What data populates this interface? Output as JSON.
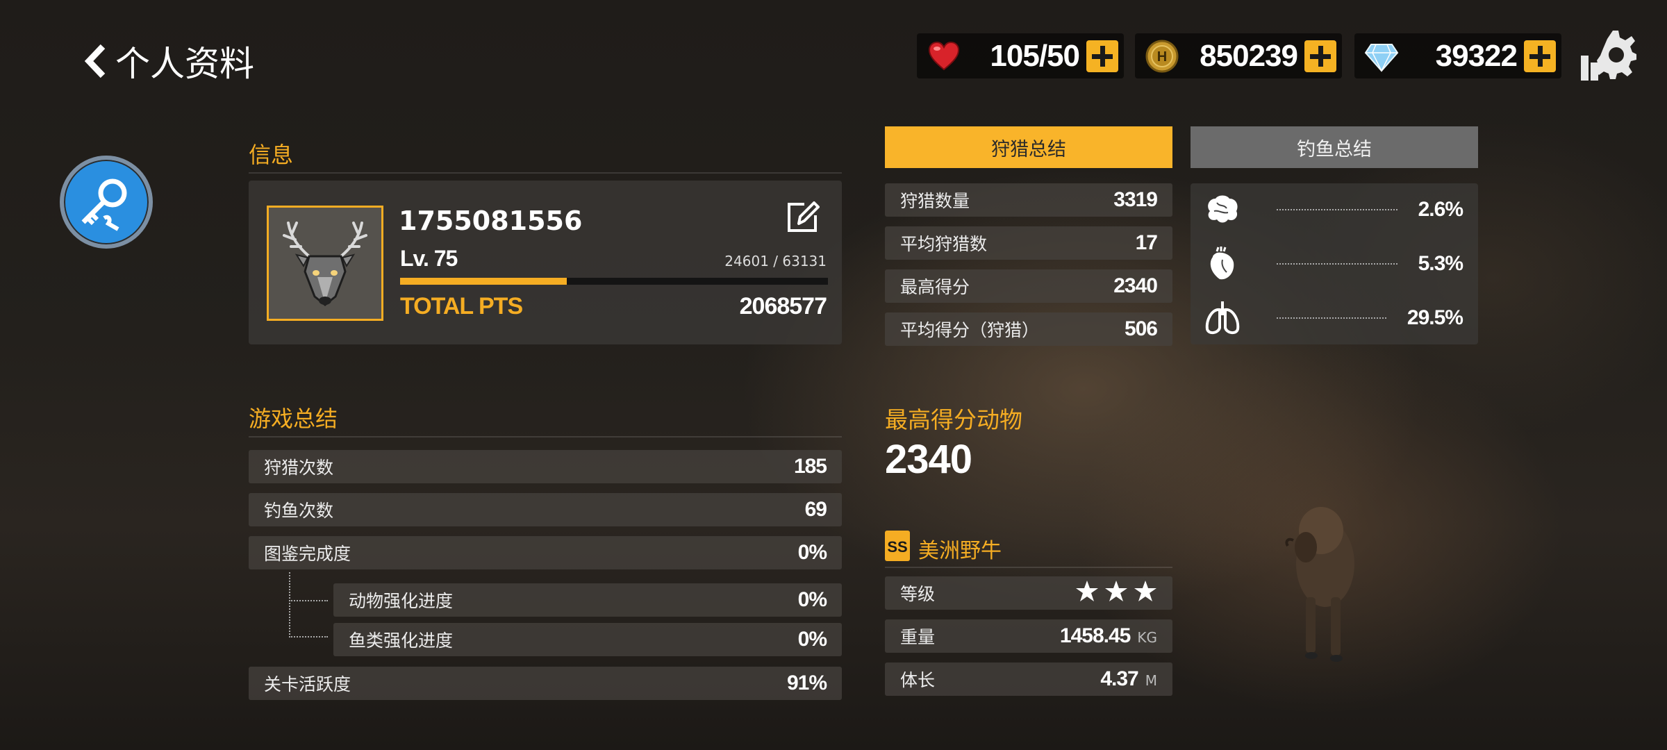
{
  "header": {
    "title": "个人资料"
  },
  "currency": {
    "hearts": "105/50",
    "coins": "850239",
    "gems": "39322"
  },
  "info": {
    "section_title": "信息",
    "user_id": "1755081556",
    "level": "Lv. 75",
    "xp": "24601 / 63131",
    "xp_progress": 0.39,
    "total_pts_label": "TOTAL PTS",
    "total_pts": "2068577"
  },
  "game_summary": {
    "section_title": "游戏总结",
    "rows": [
      {
        "label": "狩猎次数",
        "value": "185"
      },
      {
        "label": "钓鱼次数",
        "value": "69"
      },
      {
        "label": "图鉴完成度",
        "value": "0%"
      },
      {
        "label": "动物强化进度",
        "value": "0%"
      },
      {
        "label": "鱼类强化进度",
        "value": "0%"
      },
      {
        "label": "关卡活跃度",
        "value": "91%"
      }
    ]
  },
  "tabs": {
    "hunting": "狩猎总结",
    "fishing": "钓鱼总结"
  },
  "hunting_summary": {
    "rows": [
      {
        "label": "狩猎数量",
        "value": "3319"
      },
      {
        "label": "平均狩猎数",
        "value": "17"
      },
      {
        "label": "最高得分",
        "value": "2340"
      },
      {
        "label": "平均得分（狩猎）",
        "value": "506"
      }
    ]
  },
  "organ_stats": [
    {
      "icon": "brain-icon",
      "value": "2.6%"
    },
    {
      "icon": "heart-organ-icon",
      "value": "5.3%"
    },
    {
      "icon": "lungs-icon",
      "value": "29.5%"
    }
  ],
  "best_animal": {
    "section_title": "最高得分动物",
    "score": "2340",
    "badge": "SS",
    "name": "美洲野牛",
    "grade_label": "等级",
    "stars": 3,
    "weight_label": "重量",
    "weight": "1458.45",
    "weight_unit": "KG",
    "length_label": "体长",
    "length": "4.37",
    "length_unit": "M"
  },
  "colors": {
    "accent": "#f5ad23",
    "tab_inactive": "#6b6b6b",
    "magic_button": "#2a8fe0"
  }
}
